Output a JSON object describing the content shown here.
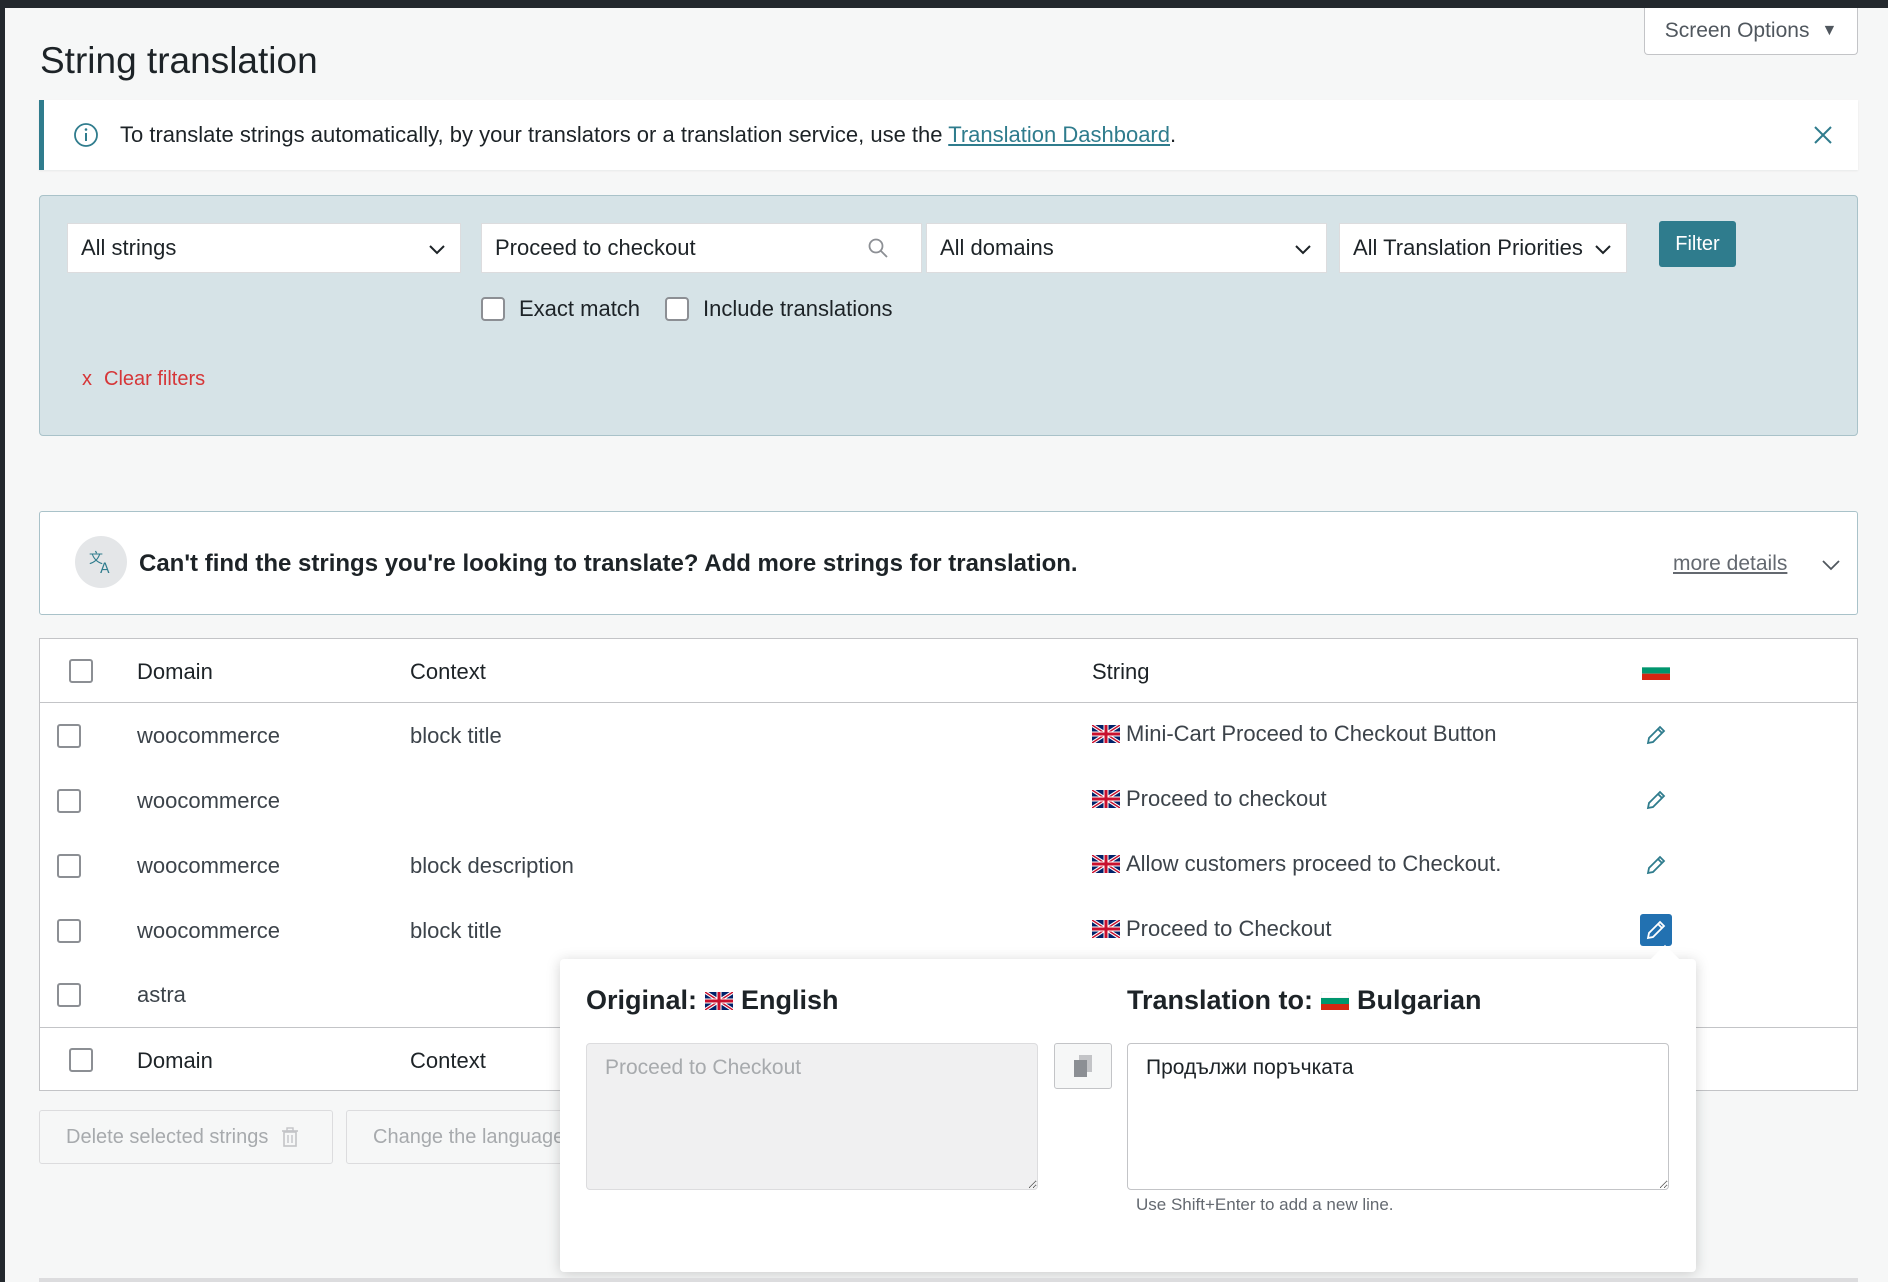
{
  "header": {
    "screen_options_label": "Screen Options",
    "page_title": "String translation"
  },
  "notice": {
    "text": "To translate strings automatically, by your translators or a translation service, use the ",
    "link_text": "Translation Dashboard",
    "suffix": "."
  },
  "filters": {
    "status_select": "All strings",
    "search_value": "Proceed to checkout",
    "domain_select": "All domains",
    "priority_select": "All Translation Priorities",
    "filter_button": "Filter",
    "exact_match_label": "Exact match",
    "include_translations_label": "Include translations",
    "clear_filters_x": "x",
    "clear_filters_label": "Clear filters"
  },
  "more_strings": {
    "message": "Can't find the strings you're looking to translate? Add more strings for translation.",
    "link": "more details"
  },
  "table": {
    "columns": {
      "domain": "Domain",
      "context": "Context",
      "string": "String"
    },
    "rows": [
      {
        "domain": "woocommerce",
        "context": "block title",
        "string": "Mini-Cart Proceed to Checkout Button"
      },
      {
        "domain": "woocommerce",
        "context": "",
        "string": "Proceed to checkout"
      },
      {
        "domain": "woocommerce",
        "context": "block description",
        "string": "Allow customers proceed to Checkout."
      },
      {
        "domain": "woocommerce",
        "context": "block title",
        "string": "Proceed to Checkout"
      },
      {
        "domain": "astra",
        "context": "",
        "string": ""
      }
    ]
  },
  "bulk_actions": {
    "delete_label": "Delete selected strings",
    "change_language_label": "Change the language"
  },
  "popup": {
    "original_label": "Original:",
    "original_language": "English",
    "translation_label": "Translation to:",
    "translation_language": "Bulgarian",
    "original_text": "Proceed to Checkout",
    "translation_text": "Продължи поръчката",
    "hint": "Use Shift+Enter to add a new line."
  },
  "colors": {
    "accent": "#2f7c8d",
    "filter_bg": "#d6e3e7",
    "danger": "#d63638",
    "active_edit": "#2271b1"
  }
}
